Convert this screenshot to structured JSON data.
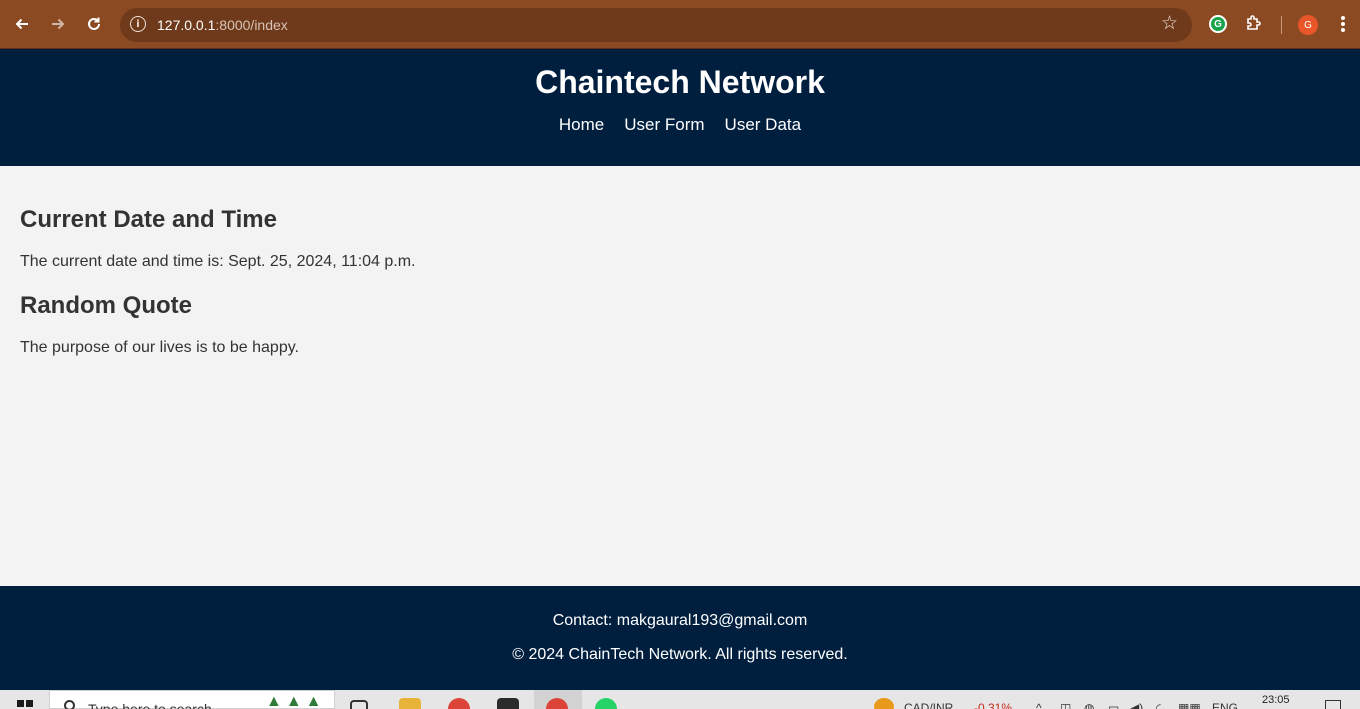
{
  "browser": {
    "url_host": "127.0.0.1",
    "url_path": ":8000/index",
    "back_icon": "arrow-left-icon",
    "forward_icon": "arrow-right-icon",
    "reload_icon": "reload-icon",
    "profile_initial": "G",
    "grammarly_initial": "G"
  },
  "site": {
    "title": "Chaintech Network",
    "nav": [
      "Home",
      "User Form",
      "User Data"
    ]
  },
  "main": {
    "datetime_heading": "Current Date and Time",
    "datetime_text": "The current date and time is: Sept. 25, 2024, 11:04 p.m.",
    "quote_heading": "Random Quote",
    "quote_text": "The purpose of our lives is to be happy."
  },
  "footer": {
    "contact": "Contact: makgaural193@gmail.com",
    "copyright": "© 2024 ChainTech Network. All rights reserved."
  },
  "taskbar": {
    "search_placeholder": "Type here to search",
    "currency_pair": "CAD/INR",
    "currency_change": "-0.31%",
    "language": "ENG",
    "clock_time": "23:05"
  },
  "colors": {
    "chrome_bg": "#8b4a22",
    "omnibox_bg": "#6e3a1b",
    "header_bg": "#001f3f",
    "page_bg": "#f3f3f3",
    "text": "#333333"
  }
}
